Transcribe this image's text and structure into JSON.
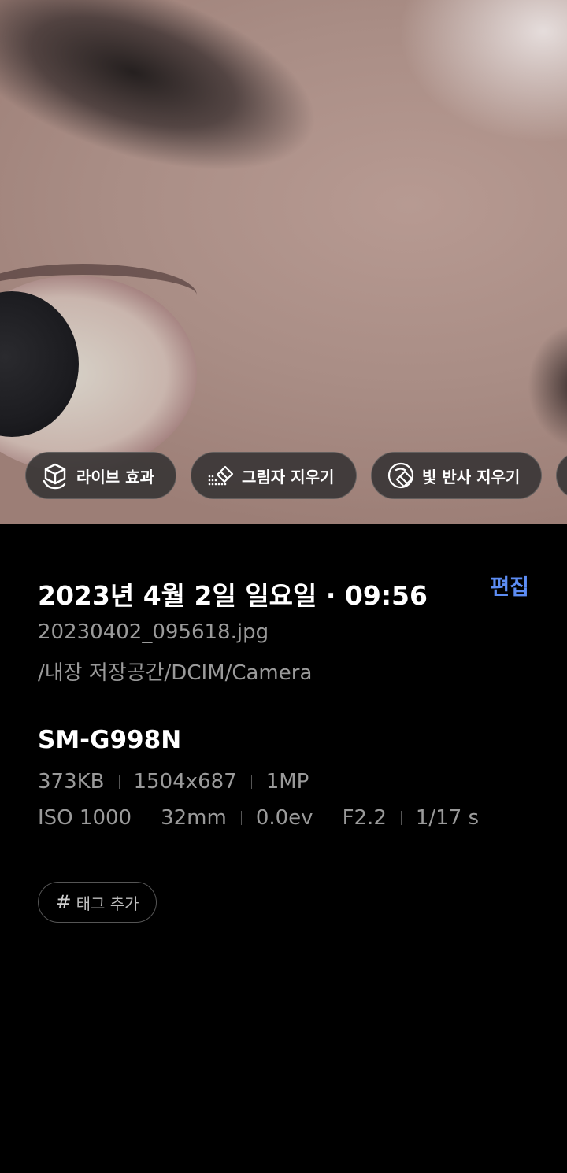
{
  "chips": [
    {
      "label": "라이브 효과",
      "icon": "live-effect-icon"
    },
    {
      "label": "그림자 지우기",
      "icon": "shadow-eraser-icon"
    },
    {
      "label": "빛 반사 지우기",
      "icon": "glare-eraser-icon"
    }
  ],
  "info": {
    "date": "2023년 4월 2일 일요일 · 09:56",
    "edit_label": "편집",
    "filename": "20230402_095618.jpg",
    "path": "/내장 저장공간/DCIM/Camera",
    "model": "SM-G998N",
    "file_specs": [
      "373KB",
      "1504x687",
      "1MP"
    ],
    "camera_specs": [
      "ISO 1000",
      "32mm",
      "0.0ev",
      "F2.2",
      "1/17 s"
    ],
    "tag_hash": "#",
    "tag_label": "태그 추가"
  },
  "colors": {
    "accent": "#5d8df4",
    "secondary_text": "#9a9a9a",
    "background": "#000000"
  }
}
